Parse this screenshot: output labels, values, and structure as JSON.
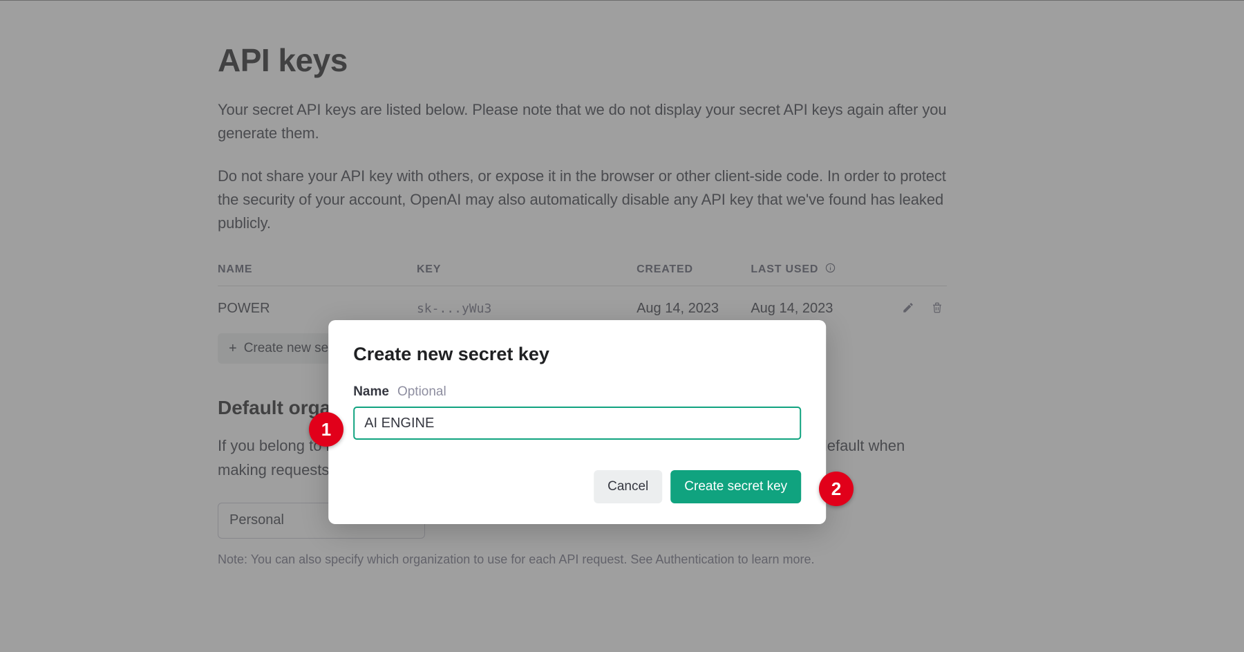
{
  "page": {
    "title": "API keys",
    "intro1": "Your secret API keys are listed below. Please note that we do not display your secret API keys again after you generate them.",
    "intro2": "Do not share your API key with others, or expose it in the browser or other client-side code. In order to protect the security of your account, OpenAI may also automatically disable any API key that we've found has leaked publicly."
  },
  "table": {
    "headers": {
      "name": "NAME",
      "key": "KEY",
      "created": "CREATED",
      "last_used": "LAST USED"
    },
    "rows": [
      {
        "name": "POWER",
        "key": "sk-...yWu3",
        "created": "Aug 14, 2023",
        "last_used": "Aug 14, 2023"
      }
    ]
  },
  "buttons": {
    "create_key": "Create new secret key"
  },
  "default_org": {
    "heading": "Default organization",
    "body": "If you belong to multiple organizations, this setting controls which organization is used by default when making requests with the API keys above.",
    "selected": "Personal",
    "note": "Note: You can also specify which organization to use for each API request. See Authentication to learn more."
  },
  "modal": {
    "title": "Create new secret key",
    "name_label": "Name",
    "name_hint": "Optional",
    "name_value": "AI ENGINE",
    "cancel": "Cancel",
    "submit": "Create secret key"
  },
  "callouts": {
    "one": "1",
    "two": "2"
  }
}
